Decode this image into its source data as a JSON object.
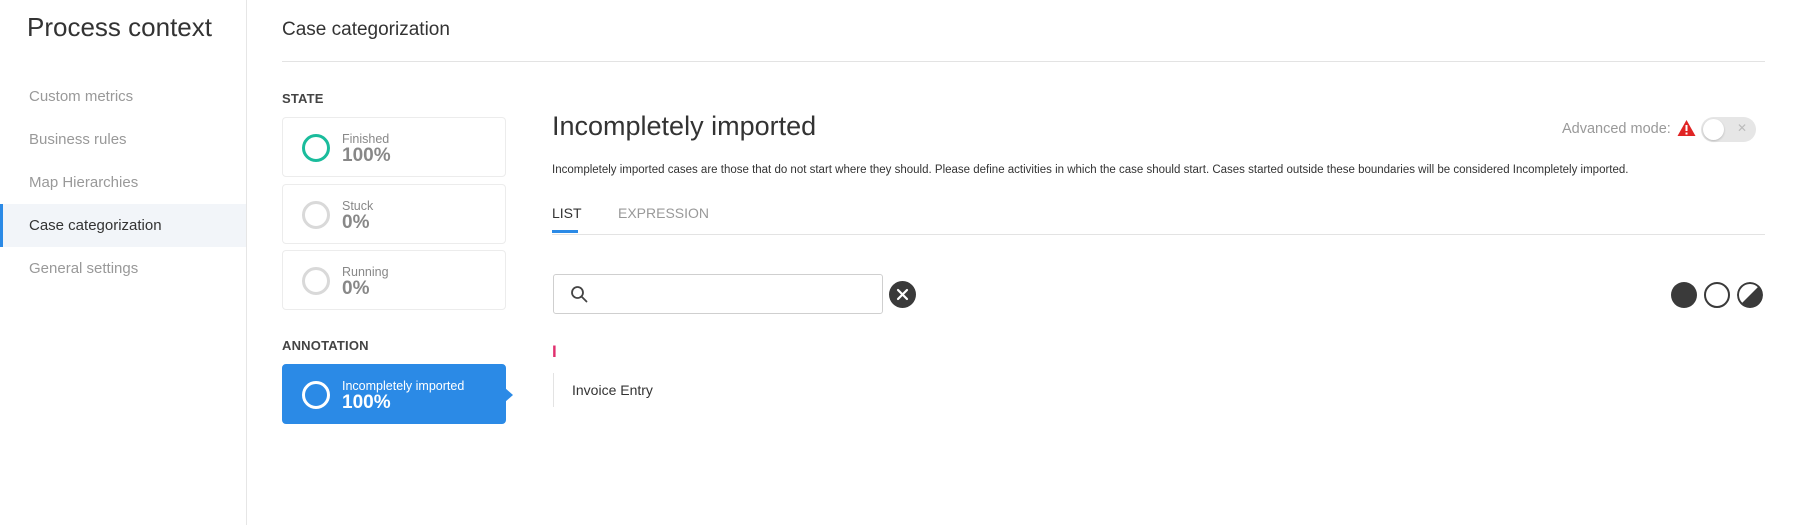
{
  "sidebar": {
    "title": "Process context",
    "items": [
      {
        "label": "Custom metrics",
        "active": false
      },
      {
        "label": "Business rules",
        "active": false
      },
      {
        "label": "Map Hierarchies",
        "active": false
      },
      {
        "label": "Case categorization",
        "active": true
      },
      {
        "label": "General settings",
        "active": false
      }
    ]
  },
  "main": {
    "title": "Case categorization",
    "state_section": {
      "label": "STATE",
      "cards": [
        {
          "label": "Finished",
          "value": "100%",
          "ring_color": "#1abc9c"
        },
        {
          "label": "Stuck",
          "value": "0%",
          "ring_color": "#d9d9d9"
        },
        {
          "label": "Running",
          "value": "0%",
          "ring_color": "#d9d9d9"
        }
      ]
    },
    "annotation_section": {
      "label": "ANNOTATION",
      "cards": [
        {
          "label": "Incompletely imported",
          "value": "100%",
          "selected": true,
          "color": "#2b8ae6"
        }
      ]
    },
    "detail": {
      "title": "Incompletely imported",
      "advanced_mode_label": "Advanced mode:",
      "advanced_mode_on": false,
      "description": "Incompletely imported cases are those that do not start where they should. Please define activities in which the case should start. Cases started outside these boundaries will be considered Incompletely imported.",
      "tabs": [
        {
          "label": "LIST",
          "active": true
        },
        {
          "label": "EXPRESSION",
          "active": false
        }
      ],
      "search": {
        "value": "",
        "placeholder": ""
      },
      "filter_icons": [
        "filled-circle-icon",
        "empty-circle-icon",
        "half-circle-icon"
      ],
      "groups": [
        {
          "letter": "I",
          "items": [
            "Invoice Entry"
          ]
        }
      ]
    }
  },
  "colors": {
    "accent": "#2b8ae6",
    "teal": "#1abc9c",
    "group_letter": "#e0306e",
    "warning": "#e02424"
  }
}
